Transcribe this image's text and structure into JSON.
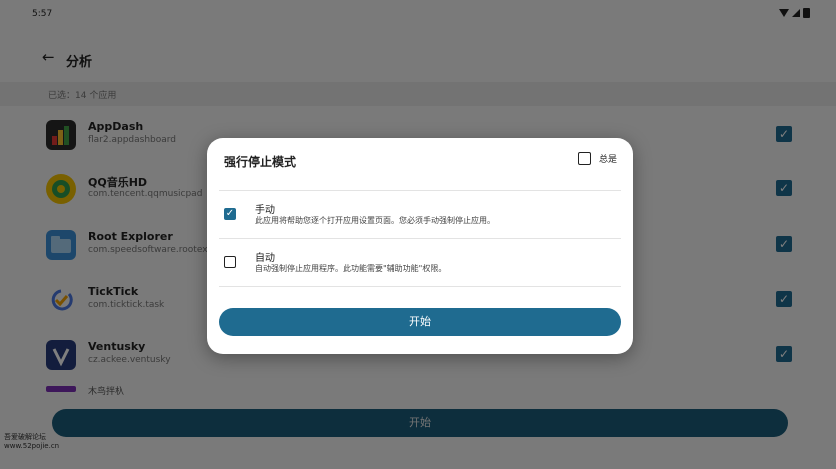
{
  "status": {
    "time": "5:57"
  },
  "appbar": {
    "back_icon": "←",
    "title": "分析"
  },
  "selection": {
    "text": "已选：14 个应用"
  },
  "apps": [
    {
      "name": "AppDash",
      "package": "flar2.appdashboard",
      "icon_color": "#2b2b2b",
      "checked": "✓"
    },
    {
      "name": "QQ音乐HD",
      "package": "com.tencent.qqmusicpad",
      "icon_color": "#f2c100",
      "checked": "✓"
    },
    {
      "name": "Root Explorer",
      "package": "com.speedsoftware.rootexplorer",
      "icon_color": "#3a8fd6",
      "checked": "✓"
    },
    {
      "name": "TickTick",
      "package": "com.ticktick.task",
      "icon_color": "#4a77e0",
      "checked": "✓"
    },
    {
      "name": "Ventusky",
      "package": "cz.ackee.ventusky",
      "icon_color": "#263a7a",
      "checked": "✓"
    }
  ],
  "partial_row": {
    "name": "木鸟拌杁"
  },
  "bottom_button": {
    "label": "开始"
  },
  "watermark": {
    "line1": "吾爱破解论坛",
    "line2": "www.52pojie.cn"
  },
  "dialog": {
    "title": "强行停止模式",
    "always_label": "总是",
    "options": [
      {
        "title": "手动",
        "desc": "此应用将帮助您逐个打开应用设置页面。您必须手动强制停止应用。",
        "checked": true,
        "mark": "✓"
      },
      {
        "title": "自动",
        "desc": "自动强制停止应用程序。此功能需要\"辅助功能\"权限。",
        "checked": false
      }
    ],
    "start_label": "开始"
  },
  "colors": {
    "accent": "#1f6b90",
    "scrim": "rgba(0,0,0,0.5)"
  }
}
